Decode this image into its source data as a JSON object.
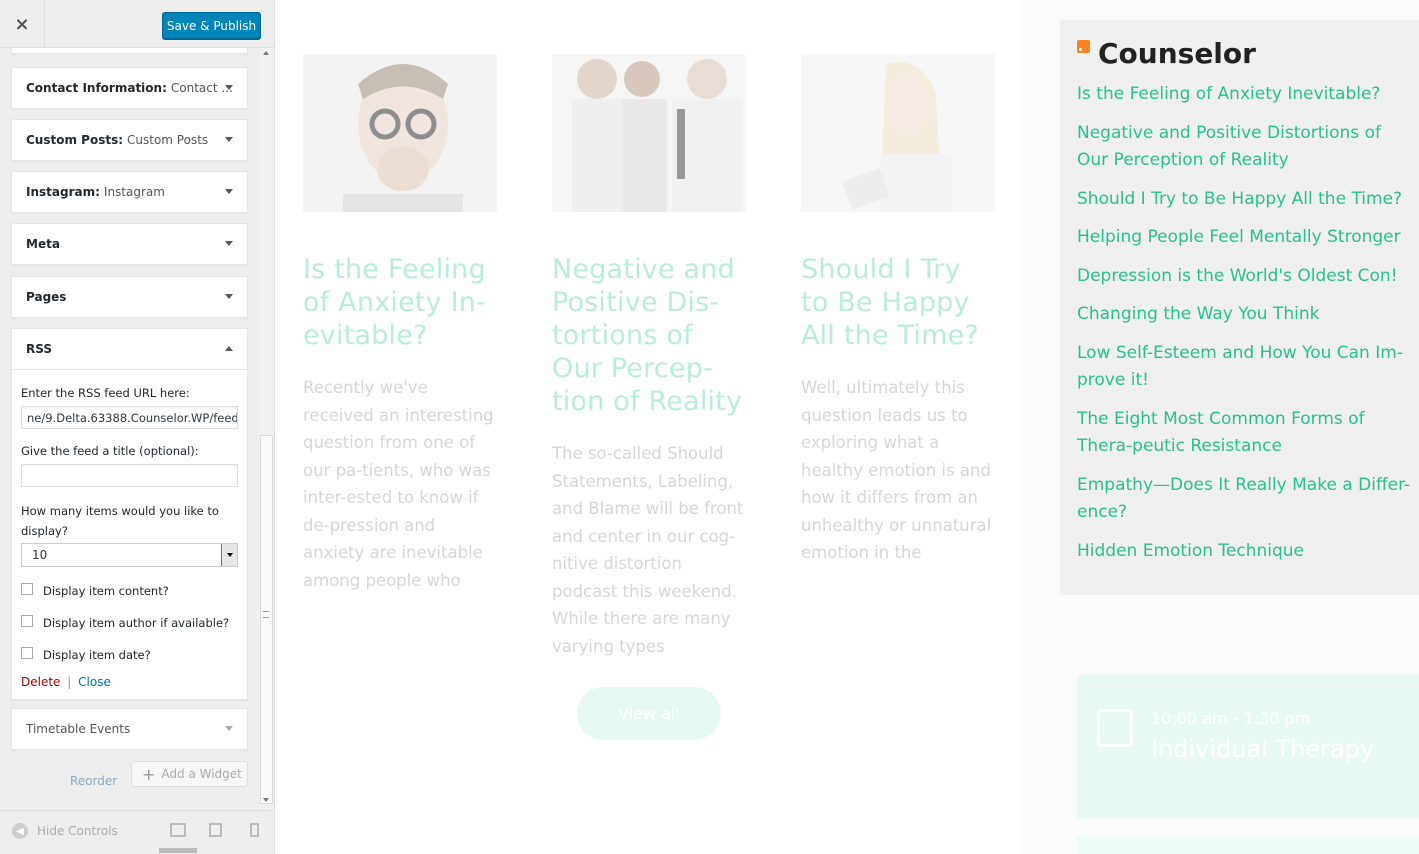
{
  "customizer": {
    "close_label": "×",
    "publish_label": "Save & Publish",
    "widgets": [
      {
        "name": "Contact Information:",
        "sub": " Contact ..."
      },
      {
        "name": "Custom Posts:",
        "sub": " Custom Posts"
      },
      {
        "name": "Instagram:",
        "sub": " Instagram"
      },
      {
        "name": "Meta",
        "sub": ""
      },
      {
        "name": "Pages",
        "sub": ""
      },
      {
        "name": "RSS",
        "sub": ""
      },
      {
        "name": "Timetable Events",
        "sub": ""
      }
    ],
    "rss_form": {
      "url_label": "Enter the RSS feed URL here:",
      "url_value": "ne/9.Delta.63388.Counselor.WP/feed",
      "title_label": "Give the feed a title (optional):",
      "title_value": "",
      "items_label": "How many items would you like to display?",
      "items_value": "10",
      "options": [
        {
          "label": "Display item content?",
          "checked": false
        },
        {
          "label": "Display item author if available?",
          "checked": false
        },
        {
          "label": "Display item date?",
          "checked": false
        }
      ],
      "delete_label": "Delete",
      "separator": "|",
      "close_label": "Close"
    },
    "reorder_label": "Reorder",
    "add_widget_label": "Add a Widget",
    "hide_controls_label": "Hide Controls"
  },
  "preview": {
    "posts": [
      {
        "title": "Is the Feeling of Anxiety In-evitable?",
        "excerpt": "Recently we've received an interesting question from one of our pa-tients, who was inter-ested to know if de-pression and anxiety are inevitable among people who"
      },
      {
        "title": "Negative and Positive Dis-tortions of Our Percep-tion of Reality",
        "excerpt": "The so-called Should Statements, Labeling, and Blame will be  front and center in our cog-nitive distortion podcast this weekend. While there are many varying types"
      },
      {
        "title": "Should I Try to Be Happy All the Time?",
        "excerpt": "Well, ultimately this question leads us to exploring what a healthy emotion is and how it differs from an unhealthy or unnatural emotion in the"
      }
    ],
    "view_all_label": "View all",
    "rss_widget": {
      "title": "Counselor",
      "items": [
        "Is the Feeling of Anxiety Inevitable?",
        "Negative and Positive Distortions of Our Perception of Reality",
        "Should I Try to Be Happy All the Time?",
        "Helping People Feel Mentally Stronger",
        "Depression is the World's Oldest Con!",
        "Changing the Way You Think",
        "Low Self-Esteem and How You Can Im-prove it!",
        "The Eight Most Common Forms of Thera-peutic Resistance",
        "Empathy—Does It Really Make a Differ-ence?",
        "Hidden Emotion Technique"
      ]
    },
    "event": {
      "time": "10:00 am - 1:30 pm",
      "name": "Individual Therapy"
    }
  },
  "colors": {
    "accent": "#25c28e",
    "publish_button": "#0085ba",
    "delete_link": "#aa0000",
    "close_link": "#0073aa"
  }
}
